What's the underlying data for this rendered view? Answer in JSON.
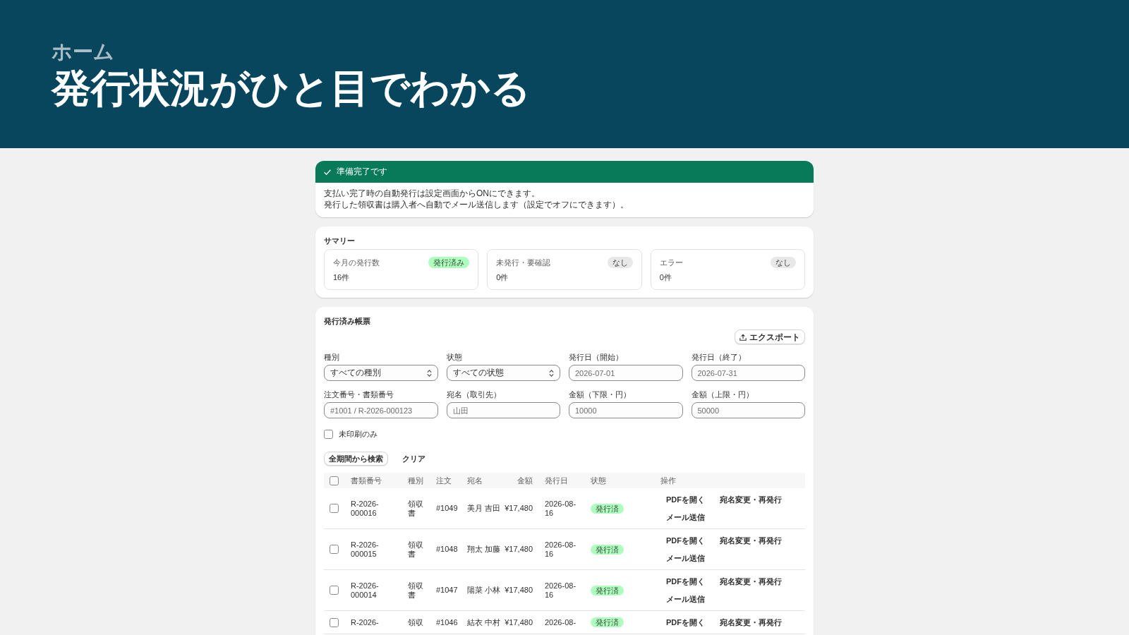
{
  "header": {
    "breadcrumb": "ホーム",
    "title": "発行状況がひと目でわかる"
  },
  "notice": {
    "title": "準備完了です",
    "lines": [
      "支払い完了時の自動発行は設定画面からONにできます。",
      "発行した領収書は購入者へ自動でメール送信します（設定でオフにできます）。"
    ]
  },
  "summary": {
    "title": "サマリー",
    "cards": [
      {
        "label": "今月の発行数",
        "value": "16件",
        "badge": {
          "text": "発行済み",
          "color": "#affebf"
        }
      },
      {
        "label": "未発行・要確認",
        "value": "0件",
        "badge": {
          "text": "なし",
          "color": "#e8e8e8"
        }
      },
      {
        "label": "エラー",
        "value": "0件",
        "badge": {
          "text": "なし",
          "color": "#e8e8e8"
        }
      }
    ]
  },
  "documents": {
    "title": "発行済み帳票",
    "export_button": "エクスポート",
    "filters": [
      {
        "kind": "select",
        "label": "種別",
        "value": "すべての種別"
      },
      {
        "kind": "select",
        "label": "状態",
        "value": "すべての状態"
      },
      {
        "kind": "text",
        "label": "発行日（開始）",
        "placeholder": "2026-07-01"
      },
      {
        "kind": "text",
        "label": "発行日（終了）",
        "placeholder": "2026-07-31"
      },
      {
        "kind": "text",
        "label": "注文番号・書類番号",
        "placeholder": "#1001 / R-2026-000123"
      },
      {
        "kind": "text",
        "label": "宛名（取引先）",
        "placeholder": "山田"
      },
      {
        "kind": "text",
        "label": "金額（下限・円）",
        "placeholder": "10000"
      },
      {
        "kind": "text",
        "label": "金額（上限・円）",
        "placeholder": "50000"
      }
    ],
    "unprinted_only": {
      "label": "未印刷のみ",
      "checked": false
    },
    "actions": [
      {
        "kind": "secondary",
        "label": "全期間から検索"
      },
      {
        "kind": "plain",
        "label": "クリア"
      }
    ],
    "table": {
      "select_all": {
        "checked": false
      },
      "columns": [
        "書類番号",
        "種別",
        "注文",
        "宛名",
        "金額",
        "発行日",
        "状態",
        "操作"
      ],
      "rows": [
        {
          "selected": false,
          "document_number": "R-2026-000016",
          "type": "領収書",
          "order": "#1049",
          "recipient": "美月 吉田",
          "amount": "¥17,480",
          "issued_on": "2026-08-16",
          "status": {
            "text": "発行済",
            "color": "#affebf"
          },
          "actions": [
            "PDFを開く",
            "宛名変更・再発行",
            "メール送信"
          ]
        },
        {
          "selected": false,
          "document_number": "R-2026-000015",
          "type": "領収書",
          "order": "#1048",
          "recipient": "翔太 加藤",
          "amount": "¥17,480",
          "issued_on": "2026-08-16",
          "status": {
            "text": "発行済",
            "color": "#affebf"
          },
          "actions": [
            "PDFを開く",
            "宛名変更・再発行",
            "メール送信"
          ]
        },
        {
          "selected": false,
          "document_number": "R-2026-000014",
          "type": "領収書",
          "order": "#1047",
          "recipient": "陽菜 小林",
          "amount": "¥17,480",
          "issued_on": "2026-08-16",
          "status": {
            "text": "発行済",
            "color": "#affebf"
          },
          "actions": [
            "PDFを開く",
            "宛名変更・再発行",
            "メール送信"
          ]
        },
        {
          "selected": false,
          "document_number": "R-2026-",
          "type": "領収",
          "order": "#1046",
          "recipient": "結衣 中村",
          "amount": "¥17,480",
          "issued_on": "2026-08-",
          "status": {
            "text": "発行済",
            "color": "#affebf"
          },
          "actions": [
            "PDFを開く",
            "宛名変更・再発行"
          ]
        }
      ]
    }
  }
}
